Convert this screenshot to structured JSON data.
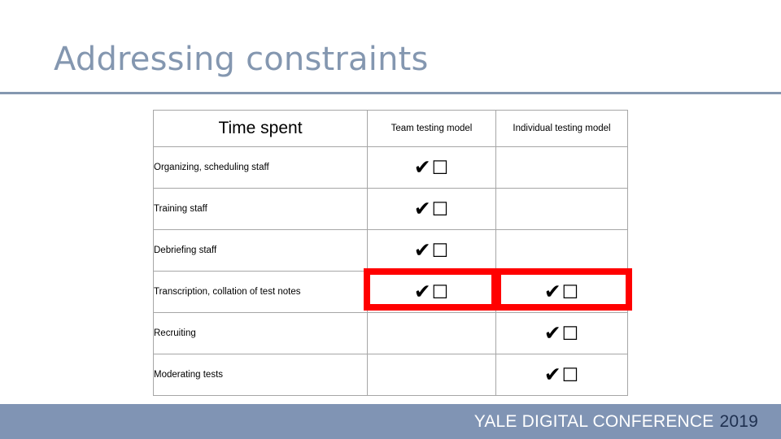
{
  "slide": {
    "title": "Addressing constraints"
  },
  "table": {
    "headers": {
      "task": "Time spent",
      "team": "Team testing model",
      "individual": "Individual testing model"
    },
    "mark_tick": "✔",
    "mark_box": "☐",
    "rows": [
      {
        "task": "Organizing, scheduling staff",
        "shaded": true,
        "team": true,
        "individual": false
      },
      {
        "task": "Training staff",
        "shaded": false,
        "team": true,
        "individual": false
      },
      {
        "task": "Debriefing staff",
        "shaded": true,
        "team": true,
        "individual": false
      },
      {
        "task": "Transcription, collation of test notes",
        "shaded": false,
        "team": true,
        "individual": true
      },
      {
        "task": "Recruiting",
        "shaded": true,
        "team": false,
        "individual": true
      },
      {
        "task": "Moderating tests",
        "shaded": false,
        "team": false,
        "individual": true
      }
    ]
  },
  "highlight": {
    "color": "#FF0000",
    "row_task": "Transcription, collation of test notes",
    "columns": [
      "Team testing model",
      "Individual testing model"
    ]
  },
  "footer": {
    "conference": "YALE DIGITAL CONFERENCE",
    "year": "2019"
  },
  "colors": {
    "title": "#8497B0",
    "rule": "#8497B0",
    "row_shade": "#A3C1EC",
    "footer_band": "#8094B4",
    "footer_year": "#1F3050",
    "highlight": "#FF0000",
    "table_border": "#A6A6A6"
  }
}
